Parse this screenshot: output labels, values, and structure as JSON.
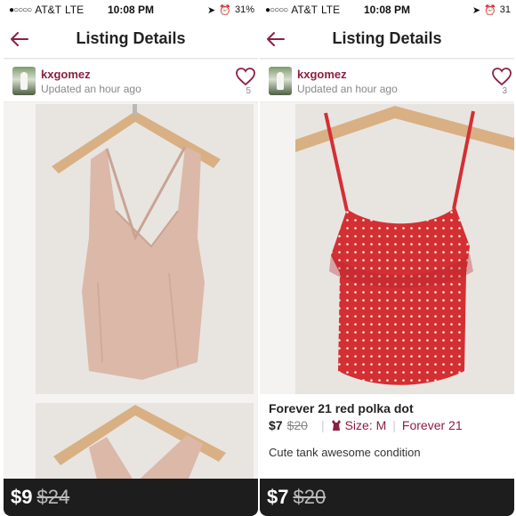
{
  "left_screen": {
    "status": {
      "signal": "●○○○○",
      "carrier": "AT&T",
      "network": "LTE",
      "time": "10:08 PM",
      "battery": "31%"
    },
    "nav": {
      "title": "Listing Details"
    },
    "seller": {
      "username": "kxgomez",
      "updated": "Updated an hour ago",
      "likes": "5"
    },
    "footer": {
      "price": "$9",
      "original_price": "$24"
    }
  },
  "right_screen": {
    "status": {
      "signal": "●○○○○",
      "carrier": "AT&T",
      "network": "LTE",
      "time": "10:08 PM",
      "battery": "31"
    },
    "nav": {
      "title": "Listing Details"
    },
    "seller": {
      "username": "kxgomez",
      "updated": "Updated an hour ago",
      "likes": "3"
    },
    "listing": {
      "title": "Forever 21 red polka dot",
      "price": "$7",
      "original_price": "$20",
      "size": "Size: M",
      "brand": "Forever 21",
      "description": "Cute tank awesome condition"
    },
    "footer": {
      "price": "$7",
      "original_price": "$20"
    }
  },
  "colors": {
    "accent": "#8d1f40",
    "footer_bg": "#1d1d1d",
    "heart": "#8d1f40",
    "tank_pink": "#dcb8a8",
    "tank_red": "#d42f33"
  },
  "icons": [
    "back-arrow-icon",
    "heart-icon",
    "hanger-icon",
    "location-icon",
    "alarm-icon",
    "dress-icon"
  ]
}
